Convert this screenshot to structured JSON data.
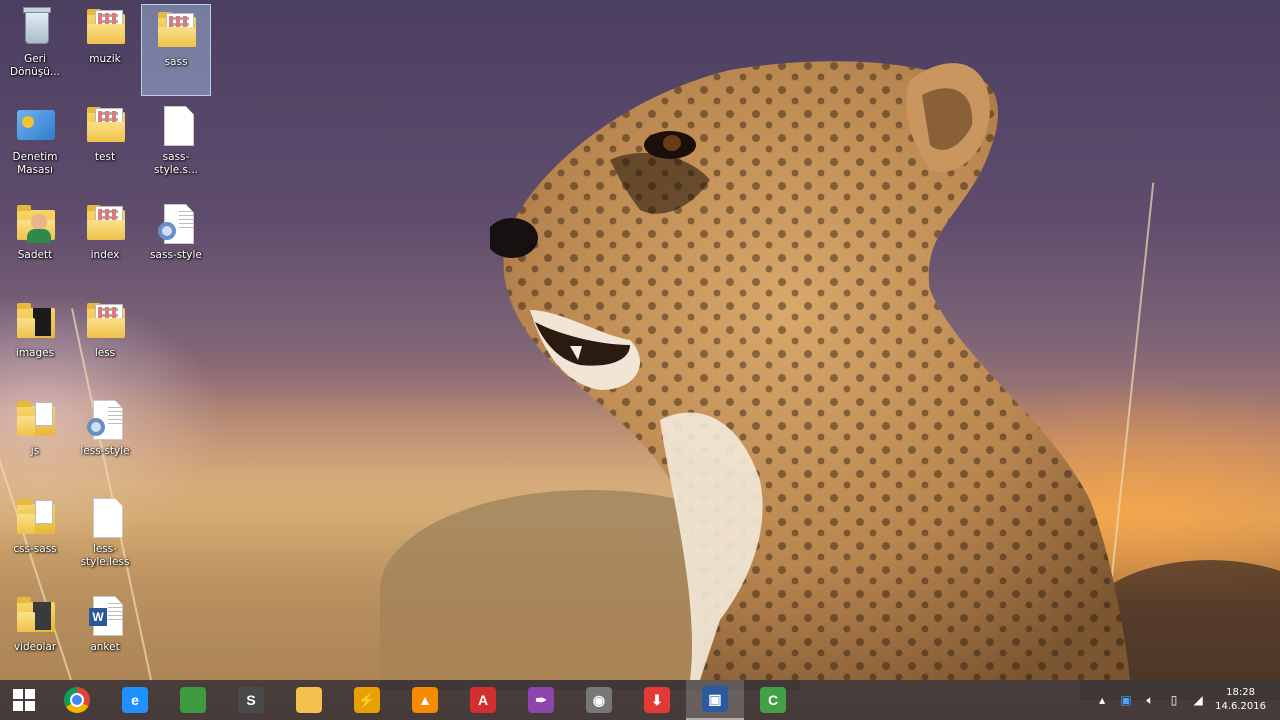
{
  "desktop": {
    "icons": [
      {
        "label": "Geri\nDönüşü...",
        "icon": "recycle-bin-icon"
      },
      {
        "label": "muzik",
        "icon": "folder-icon"
      },
      {
        "label": "sass",
        "icon": "folder-icon"
      },
      {
        "label": "Denetim\nMasası",
        "icon": "control-panel-icon"
      },
      {
        "label": "test",
        "icon": "folder-icon"
      },
      {
        "label": "sass-style.s...",
        "icon": "file-icon"
      },
      {
        "label": "Sadett",
        "icon": "user-folder-icon"
      },
      {
        "label": "index",
        "icon": "folder-icon"
      },
      {
        "label": "sass-style",
        "icon": "config-file-icon"
      },
      {
        "label": "images",
        "icon": "folder-icon"
      },
      {
        "label": "less",
        "icon": "folder-icon"
      },
      {
        "label": "js",
        "icon": "folder-icon"
      },
      {
        "label": "less-style",
        "icon": "config-file-icon"
      },
      {
        "label": "css-sass",
        "icon": "folder-icon"
      },
      {
        "label": "less-style.less",
        "icon": "file-icon"
      },
      {
        "label": "videolar",
        "icon": "folder-icon"
      },
      {
        "label": "anket",
        "icon": "word-document-icon"
      }
    ]
  },
  "taskbar": {
    "apps": [
      {
        "icon": "chrome-icon",
        "letter": "",
        "color": "#db4437"
      },
      {
        "icon": "internet-explorer-icon",
        "letter": "e",
        "color": "#1e90ff"
      },
      {
        "icon": "spreadsheet-app-icon",
        "letter": "",
        "color": "#3f9b3f"
      },
      {
        "icon": "sublime-text-icon",
        "letter": "S",
        "color": "#4a4a4a"
      },
      {
        "icon": "file-explorer-icon",
        "letter": "",
        "color": "#f2c14e"
      },
      {
        "icon": "winamp-icon",
        "letter": "⚡",
        "color": "#e6a100"
      },
      {
        "icon": "vlc-icon",
        "letter": "▲",
        "color": "#f48b00"
      },
      {
        "icon": "acrobat-icon",
        "letter": "A",
        "color": "#d32f2f"
      },
      {
        "icon": "feather-app-icon",
        "letter": "✒",
        "color": "#8e44ad"
      },
      {
        "icon": "mask-app-icon",
        "letter": "◉",
        "color": "#777777"
      },
      {
        "icon": "download-manager-icon",
        "letter": "⬇",
        "color": "#e53935"
      },
      {
        "icon": "recorder-icon",
        "letter": "▣",
        "color": "#2c5aa0"
      },
      {
        "icon": "camtasia-icon",
        "letter": "C",
        "color": "#43a047"
      }
    ],
    "active_index": 11,
    "tray": {
      "icons": [
        "show-hidden-icon",
        "network-app-icon",
        "volume-icon",
        "power-icon",
        "signal-icon"
      ],
      "time": "18:28",
      "date": "14.6.2016"
    }
  }
}
